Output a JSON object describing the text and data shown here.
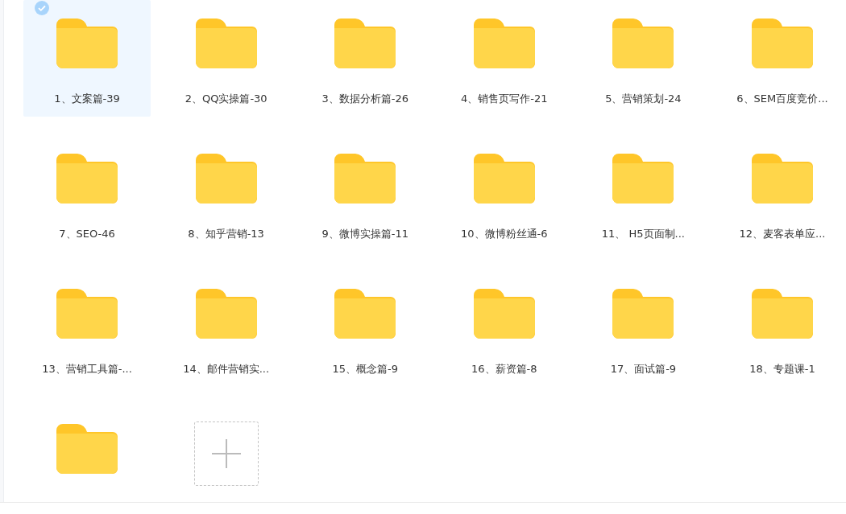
{
  "items": [
    {
      "kind": "folder",
      "label": "1、文案篇-39",
      "selected": true
    },
    {
      "kind": "folder",
      "label": "2、QQ实操篇-30",
      "selected": false
    },
    {
      "kind": "folder",
      "label": "3、数据分析篇-26",
      "selected": false
    },
    {
      "kind": "folder",
      "label": "4、销售页写作-21",
      "selected": false
    },
    {
      "kind": "folder",
      "label": "5、营销策划-24",
      "selected": false
    },
    {
      "kind": "folder",
      "label": "6、SEM百度竞价...",
      "selected": false
    },
    {
      "kind": "folder",
      "label": "7、SEO-46",
      "selected": false
    },
    {
      "kind": "folder",
      "label": "8、知乎营销-13",
      "selected": false
    },
    {
      "kind": "folder",
      "label": "9、微博实操篇-11",
      "selected": false
    },
    {
      "kind": "folder",
      "label": "10、微博粉丝通-6",
      "selected": false
    },
    {
      "kind": "folder",
      "label": "11、 H5页面制...",
      "selected": false
    },
    {
      "kind": "folder",
      "label": "12、麦客表单应...",
      "selected": false
    },
    {
      "kind": "folder",
      "label": "13、营销工具篇-...",
      "selected": false
    },
    {
      "kind": "folder",
      "label": "14、邮件营销实...",
      "selected": false
    },
    {
      "kind": "folder",
      "label": "15、概念篇-9",
      "selected": false
    },
    {
      "kind": "folder",
      "label": "16、薪资篇-8",
      "selected": false
    },
    {
      "kind": "folder",
      "label": "17、面试篇-9",
      "selected": false
    },
    {
      "kind": "folder",
      "label": "18、专题课-1",
      "selected": false
    },
    {
      "kind": "folder",
      "selected": false
    },
    {
      "kind": "upload",
      "selected": false
    }
  ]
}
